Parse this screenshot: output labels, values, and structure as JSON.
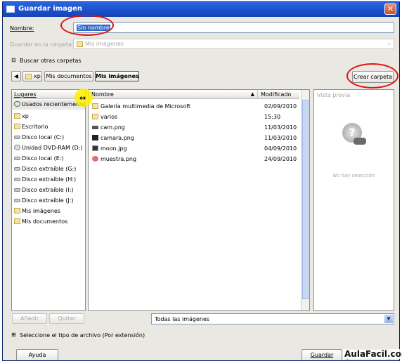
{
  "window": {
    "title": "Guardar imagen",
    "close_symbol": "✕"
  },
  "name_row": {
    "label": "Nombre:",
    "value": "Sin nombre"
  },
  "folder_row": {
    "label": "Guardar en la carpeta:",
    "value": "Mis imágenes"
  },
  "browse": {
    "toggle_symbol": "⊟",
    "label": "Buscar otras carpetas"
  },
  "path_bar": {
    "back_symbol": "◀",
    "items": [
      "xp",
      "Mis documentos",
      "Mis imágenes"
    ]
  },
  "create_folder_label": "Crear carpeta",
  "places": {
    "header": "Lugares",
    "items": [
      "Usados recientemente",
      "xp",
      "Escritorio",
      "Disco local (C:)",
      "Unidad DVD-RAM (D:)",
      "Disco local (E:)",
      "Disco extraíble (G:)",
      "Disco extraíble (H:)",
      "Disco extraíble (I:)",
      "Disco extraíble (J:)",
      "Mis imágenes",
      "Mis documentos"
    ]
  },
  "files": {
    "col_name": "Nombre",
    "col_modified": "Modificado",
    "sort_symbol": "▲",
    "rows": [
      {
        "name": "Galería multimedia de Microsoft",
        "modified": "02/09/2010",
        "icon": "folder-icon"
      },
      {
        "name": "varios",
        "modified": "15:30",
        "icon": "folder-icon"
      },
      {
        "name": "cam.png",
        "modified": "11/03/2010",
        "icon": "image-icon"
      },
      {
        "name": "camara.png",
        "modified": "11/03/2010",
        "icon": "image-icon"
      },
      {
        "name": "moon.jpg",
        "modified": "04/09/2010",
        "icon": "image-icon"
      },
      {
        "name": "muestra.png",
        "modified": "24/09/2010",
        "icon": "image-icon"
      }
    ]
  },
  "preview": {
    "header": "Vista previa",
    "empty_text": "No hay selección",
    "question_symbol": "?"
  },
  "add_label": "Añadir",
  "remove_label": "Quitar",
  "filter": {
    "value": "Todas las imágenes",
    "arrow": "▼"
  },
  "filetype": {
    "toggle_symbol": "⊞",
    "label": "Seleccione el tipo de archivo (Por extensión)"
  },
  "help_label": "Ayuda",
  "save_label": "Guardar",
  "watermark": "AulaFacil.com",
  "colors": {
    "accent": "#316ac5",
    "title_bar": "#1a4fc9",
    "annotation_red": "#e01010"
  }
}
